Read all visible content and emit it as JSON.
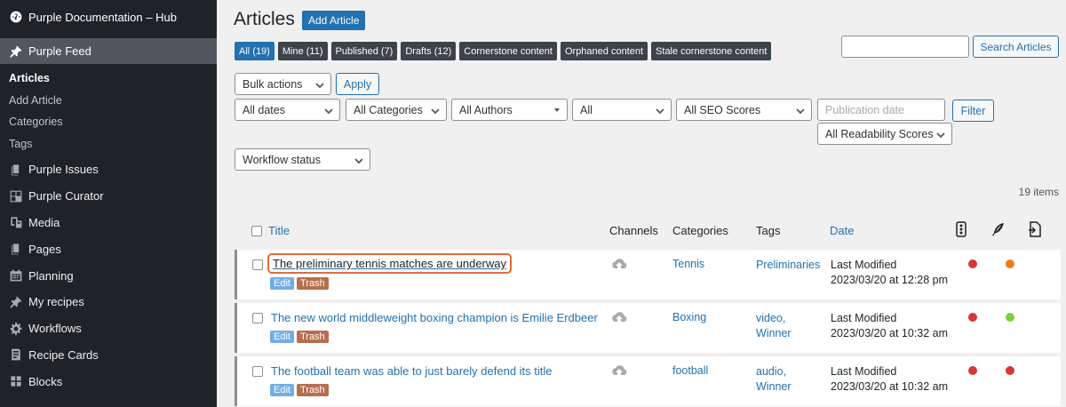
{
  "sidebar": {
    "site_title": "Purple Documentation – Hub",
    "feed_label": "Purple Feed",
    "sub_items": [
      {
        "label": "Articles"
      },
      {
        "label": "Add Article"
      },
      {
        "label": "Categories"
      },
      {
        "label": "Tags"
      }
    ],
    "menu_items": [
      {
        "label": "Purple Issues",
        "icon": "pages-icon"
      },
      {
        "label": "Purple Curator",
        "icon": "grid-plus-icon"
      },
      {
        "label": "Media",
        "icon": "media-icon"
      },
      {
        "label": "Pages",
        "icon": "pages-icon"
      },
      {
        "label": "Planning",
        "icon": "calendar-icon"
      },
      {
        "label": "My recipes",
        "icon": "pin-icon"
      },
      {
        "label": "Workflows",
        "icon": "gear-icon"
      },
      {
        "label": "Recipe Cards",
        "icon": "recipe-card-icon"
      },
      {
        "label": "Blocks",
        "icon": "blocks-icon"
      }
    ]
  },
  "header": {
    "title": "Articles",
    "add_button": "Add Article"
  },
  "filters": [
    {
      "label": "All (19)",
      "active": true
    },
    {
      "label": "Mine (11)"
    },
    {
      "label": "Published (7)"
    },
    {
      "label": "Drafts (12)"
    },
    {
      "label": "Cornerstone content"
    },
    {
      "label": "Orphaned content"
    },
    {
      "label": "Stale cornerstone content"
    }
  ],
  "search": {
    "button": "Search Articles",
    "value": ""
  },
  "bulk": {
    "selected": "Bulk actions",
    "apply": "Apply"
  },
  "dropdowns": {
    "dates": "All dates",
    "categories": "All Categories",
    "authors": "All Authors",
    "all": "All",
    "seo": "All SEO Scores",
    "readability": "All Readability Scores",
    "workflow": "Workflow status"
  },
  "date_filter": {
    "placeholder": "Publication date",
    "filter_button": "Filter"
  },
  "items_count": "19 items",
  "table": {
    "headers": {
      "title": "Title",
      "channels": "Channels",
      "categories": "Categories",
      "tags": "Tags",
      "date": "Date"
    },
    "rows": [
      {
        "title": "The preliminary tennis matches are underway",
        "edit": "Edit",
        "trash": "Trash",
        "category": "Tennis",
        "tags_line1": "Preliminaries",
        "tags_line2": "",
        "date_status": "Last Modified",
        "date_value": "2023/03/20 at 12:28 pm",
        "seo_color": "#d63638",
        "readability_color": "#ee7c1b"
      },
      {
        "title": "The new world middleweight boxing champion is Emilie Erdbeer",
        "edit": "Edit",
        "trash": "Trash",
        "category": "Boxing",
        "tags_line1": "video,",
        "tags_line2": "Winner",
        "date_status": "Last Modified",
        "date_value": "2023/03/20 at 10:32 am",
        "seo_color": "#d63638",
        "readability_color": "#7ad03a"
      },
      {
        "title": "The football team was able to just barely defend its title",
        "edit": "Edit",
        "trash": "Trash",
        "category": "football",
        "tags_line1": "audio,",
        "tags_line2": "Winner",
        "date_status": "Last Modified",
        "date_value": "2023/03/20 at 10:32 am",
        "seo_color": "#d63638",
        "readability_color": "#d63638"
      }
    ]
  }
}
